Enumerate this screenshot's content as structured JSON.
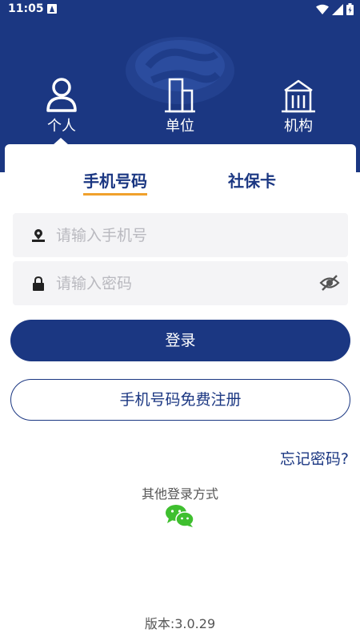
{
  "status_bar": {
    "time": "11:05",
    "icons": [
      "notification-a-icon",
      "wifi-icon",
      "signal-icon",
      "battery-icon"
    ]
  },
  "roles": {
    "selected": "个人",
    "items": [
      {
        "label": "个人",
        "icon": "person-icon"
      },
      {
        "label": "单位",
        "icon": "building-icon"
      },
      {
        "label": "机构",
        "icon": "institution-icon"
      }
    ]
  },
  "login_tabs": {
    "selected": "手机号码",
    "items": [
      "手机号码",
      "社保卡"
    ]
  },
  "form": {
    "phone_placeholder": "请输入手机号",
    "phone_value": "",
    "password_placeholder": "请输入密码",
    "password_value": ""
  },
  "actions": {
    "login_label": "登录",
    "register_label": "手机号码免费注册",
    "forgot_label": "忘记密码?"
  },
  "other_login": {
    "title": "其他登录方式",
    "icon": "wechat-icon"
  },
  "footer": {
    "version": "版本:3.0.29"
  },
  "colors": {
    "primary": "#1b3782",
    "accent": "#f0a12c",
    "input_bg": "#f4f4f6",
    "wechat": "#3fbf2f"
  }
}
